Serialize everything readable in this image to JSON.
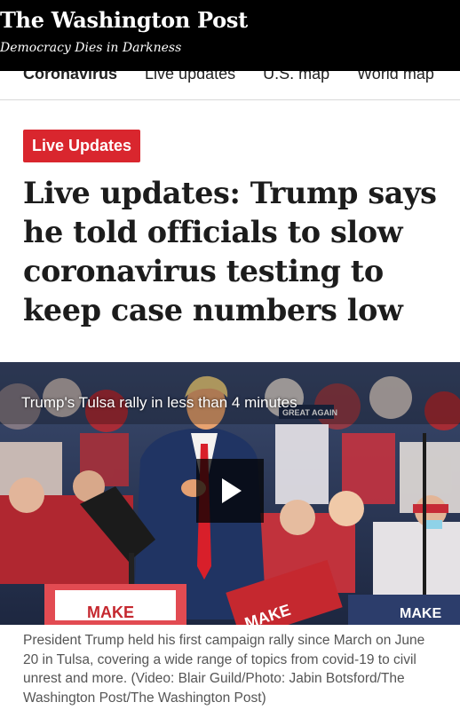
{
  "masthead": {
    "logo": "The Washington Post",
    "tagline": "Democracy Dies in Darkness"
  },
  "nav": {
    "items": [
      "Coronavirus",
      "Live updates",
      "U.S. map",
      "World map"
    ]
  },
  "article": {
    "badge": "Live Updates",
    "headline": "Live updates: Trump says he told officials to slow coronavirus testing to keep case numbers low",
    "video_title": "Trump's Tulsa rally in less than 4 minutes",
    "sign_text_1": "MAKE",
    "sign_text_2": "MAKE",
    "sign_text_3": "MAKE",
    "sign_text_4": "GREAT AGAIN",
    "caption": "President Trump held his first campaign rally since March on June 20 in Tulsa, covering a wide range of topics from covid-19 to civil unrest and more. (Video: Blair Guild/Photo: Jabin Botsford/The Washington Post/The Washington Post)"
  },
  "colors": {
    "badge_red": "#d9262e",
    "masthead_black": "#000000",
    "caption_gray": "#555555"
  },
  "icons": {
    "play": "play-icon"
  }
}
